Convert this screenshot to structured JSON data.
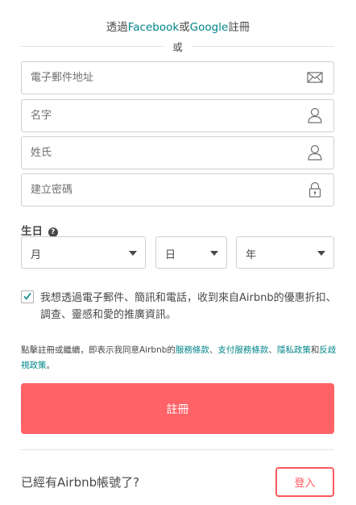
{
  "social": {
    "prefix": "透過",
    "facebook": "Facebook",
    "or": "或",
    "google": "Google",
    "suffix": "註冊"
  },
  "divider": {
    "text": "或"
  },
  "fields": {
    "email_placeholder": "電子郵件地址",
    "first_name_placeholder": "名字",
    "last_name_placeholder": "姓氏",
    "password_placeholder": "建立密碼"
  },
  "birthday": {
    "label": "生日",
    "help_icon": "?",
    "month": "月",
    "day": "日",
    "year": "年"
  },
  "consent": {
    "checked": true,
    "text": "我想透過電子郵件、簡訊和電話，收到來自Airbnb的優惠折扣、調查、靈感和愛的推廣資訊。"
  },
  "terms": {
    "prefix": "點擊註冊或繼續，即表示我同意Airbnb的",
    "service_terms": "服務條款",
    "sep1": "、",
    "payment_terms": "支付服務條款",
    "sep2": "、",
    "privacy_policy": "隱私政策",
    "and": "和",
    "nondiscrimination": "反歧視政策",
    "end": "。"
  },
  "signup_button": "註冊",
  "footer": {
    "already_text": "已經有Airbnb帳號了?",
    "login_button": "登入"
  },
  "colors": {
    "brand": "#ff5a5f",
    "link": "#008489",
    "text": "#484848"
  }
}
